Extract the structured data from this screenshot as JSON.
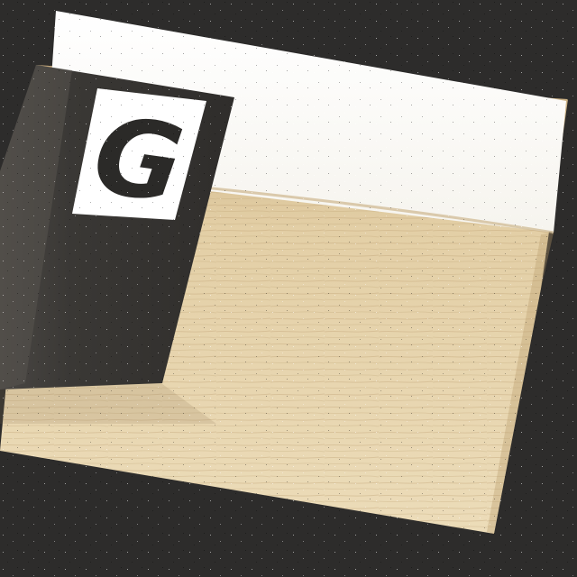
{
  "scene": {
    "sign_letter": "G"
  },
  "colors": {
    "background": "#2d2c2b",
    "floor_light": "#ead8b4",
    "floor_dark": "#c9ad80",
    "wall": "#fdfdfb",
    "block": "#353331",
    "sign_bg": "#ffffff",
    "letter": "#2b2a28"
  },
  "icons": {
    "sign": "letter-g-sign-icon"
  }
}
